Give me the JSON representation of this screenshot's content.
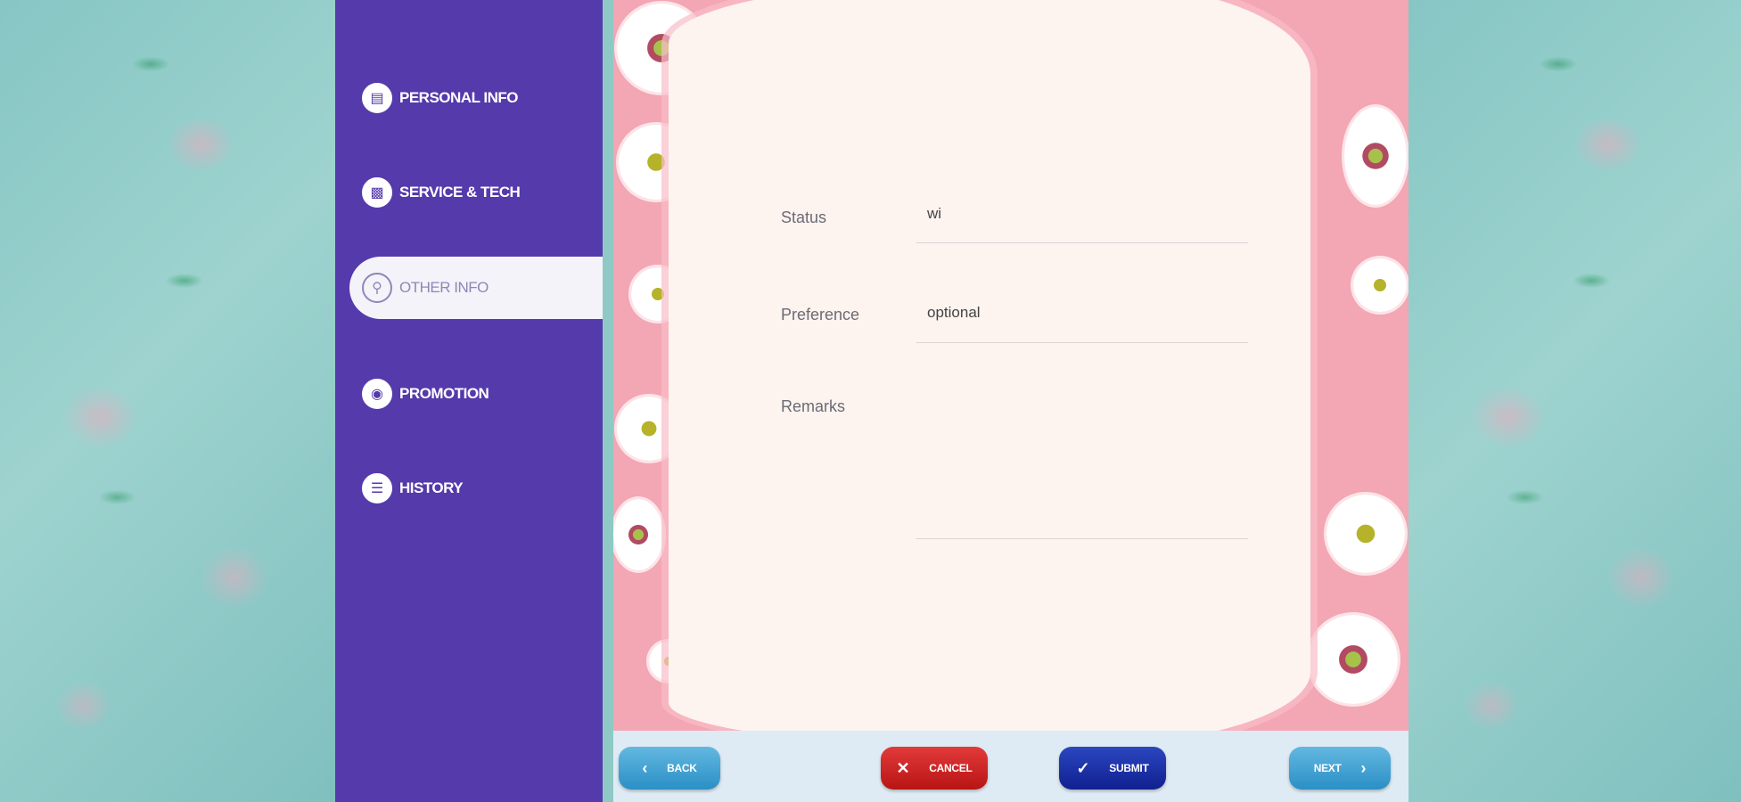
{
  "sidebar": {
    "items": [
      {
        "label": "PERSONAL INFO",
        "icon": "id-card-icon"
      },
      {
        "label": "SERVICE & TECH",
        "icon": "chart-icon"
      },
      {
        "label": "OTHER INFO",
        "icon": "search-doc-icon",
        "active": true
      },
      {
        "label": "PROMOTION",
        "icon": "camera-icon"
      },
      {
        "label": "HISTORY",
        "icon": "list-icon"
      }
    ]
  },
  "form": {
    "status_label": "Status",
    "status_value": "wi",
    "preference_label": "Preference",
    "preference_value": "optional",
    "remarks_label": "Remarks",
    "remarks_value": ""
  },
  "buttons": {
    "back": "BACK",
    "cancel": "CANCEL",
    "submit": "SUBMIT",
    "next": "NEXT"
  },
  "colors": {
    "sidebar": "#553aab",
    "back_next": "#2b8fc6",
    "cancel": "#c81e1e",
    "submit": "#1a2ea5"
  }
}
